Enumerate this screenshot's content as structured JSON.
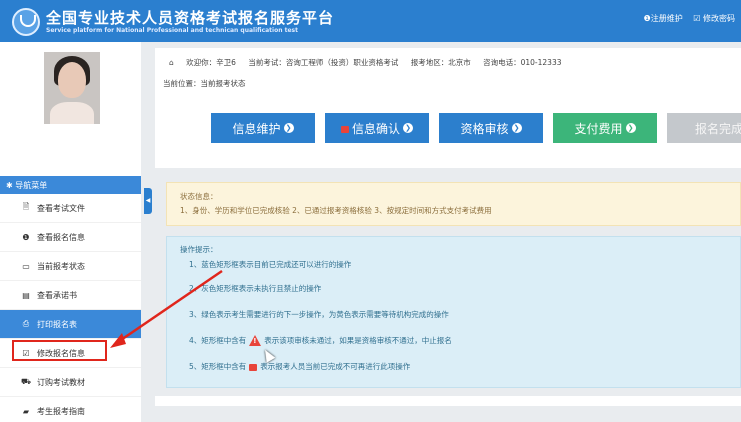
{
  "header": {
    "title_cn": "全国专业技术人员资格考试报名服务平台",
    "title_en": "Service platform for National Professional and technican qualification test",
    "links": [
      "❶注册维护",
      "☑ 修改密码"
    ]
  },
  "info": {
    "welcome": "欢迎你：辛卫6",
    "exam": "当前考试：咨询工程师（投资）职业资格考试",
    "region": "报考地区：北京市",
    "phone": "咨询电话：010-12333",
    "breadcrumb": "当前位置：当前报考状态"
  },
  "steps": [
    {
      "label": "信息维护",
      "style": "blue",
      "icon": "arrow-circle-icon"
    },
    {
      "label": "信息确认",
      "style": "blue",
      "icon": "lock-icon"
    },
    {
      "label": "资格审核",
      "style": "blue",
      "icon": "arrow-circle-icon"
    },
    {
      "label": "支付费用",
      "style": "green",
      "icon": "arrow-circle-icon"
    },
    {
      "label": "报名完成",
      "style": "gray",
      "icon": ""
    }
  ],
  "menu": {
    "header": "✱ 导航菜单",
    "items": [
      {
        "label": "查看考试文件",
        "icon": "document-icon",
        "active": false
      },
      {
        "label": "查看报名信息",
        "icon": "info-circle-icon",
        "active": false
      },
      {
        "label": "当前报考状态",
        "icon": "monitor-icon",
        "active": false
      },
      {
        "label": "查看承诺书",
        "icon": "card-icon",
        "active": false
      },
      {
        "label": "打印报名表",
        "icon": "printer-icon",
        "active": true
      },
      {
        "label": "修改报名信息",
        "icon": "edit-icon",
        "active": false
      },
      {
        "label": "订购考试教材",
        "icon": "cart-icon",
        "active": false
      },
      {
        "label": "考生报考指南",
        "icon": "book-icon",
        "active": false
      }
    ]
  },
  "status": {
    "title": "状态信息：",
    "body": "1、身份、学历和学位已完成核验 2、已通过报考资格核验 3、按规定时间和方式支付考试费用"
  },
  "tips": {
    "title": "操作提示：",
    "items": [
      "1、蓝色矩形框表示目前已完成还可以进行的操作",
      "2、灰色矩形框表示未执行且禁止的操作",
      "3、绿色表示考生需要进行的下一步操作，为黄色表示需要等待机构完成的操作",
      "4、矩形框中含有",
      "表示该项审核未通过，如果是资格审核不通过，中止报名",
      "5、矩形框中含有",
      "表示报考人员当前已完成不可再进行此项操作"
    ]
  },
  "colors": {
    "header": "#2b7fcf",
    "step_blue": "#2c7fcd",
    "step_green": "#3cb57a",
    "step_gray": "#c4c8cc",
    "annotation_red": "#e0261c"
  }
}
